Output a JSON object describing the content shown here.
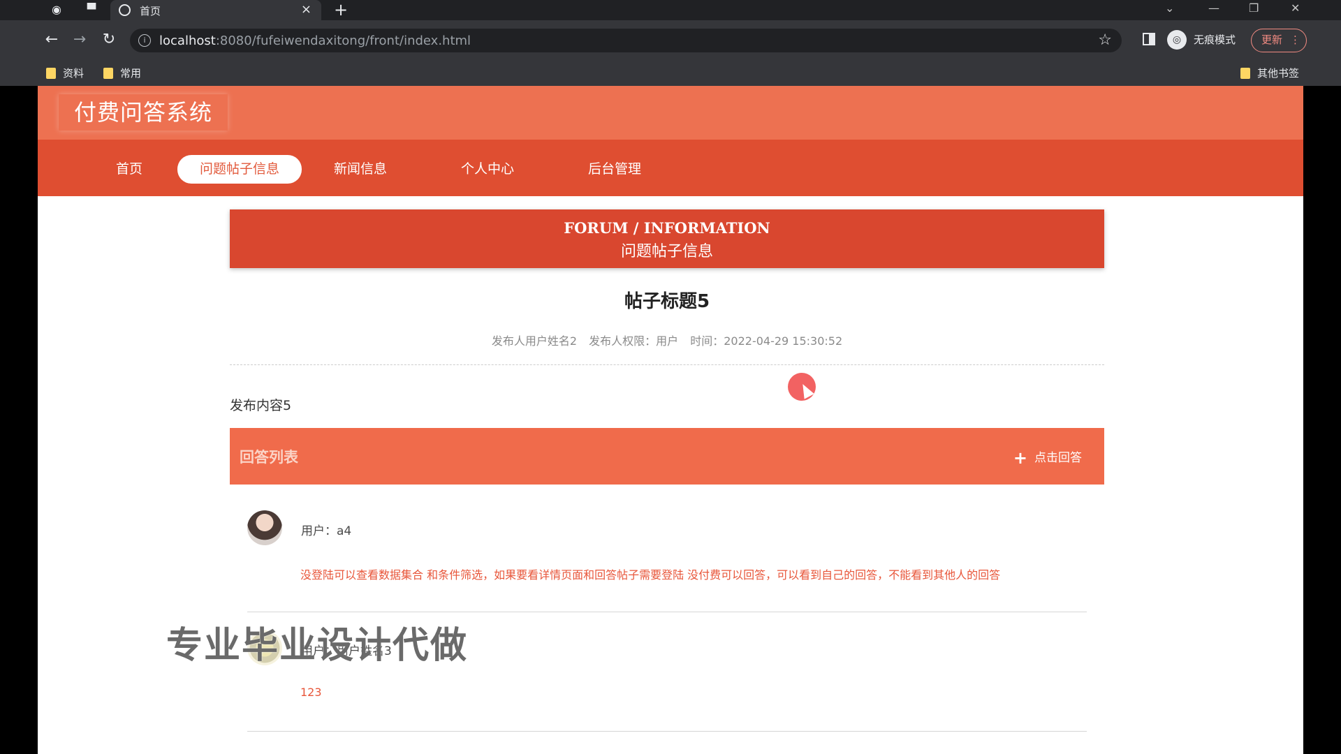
{
  "browser": {
    "tab_title": "首页",
    "url_host": "localhost",
    "url_rest": ":8080/fufeiwendaxitong/front/index.html",
    "incognito_label": "无痕模式",
    "update_label": "更新",
    "bookmarks": [
      "资料",
      "常用"
    ],
    "other_bookmarks": "其他书签"
  },
  "site": {
    "logo": "付费问答系统",
    "nav": [
      {
        "label": "首页",
        "active": false
      },
      {
        "label": "问题帖子信息",
        "active": true
      },
      {
        "label": "新闻信息",
        "active": false
      },
      {
        "label": "个人中心",
        "active": false
      },
      {
        "label": "后台管理",
        "active": false
      }
    ]
  },
  "banner": {
    "en": "FORUM / INFORMATION",
    "cn": "问题帖子信息"
  },
  "post": {
    "title": "帖子标题5",
    "meta_author": "发布人用户姓名2",
    "meta_role": "发布人权限：用户",
    "meta_time": "时间：2022-04-29 15:30:52",
    "content": "发布内容5"
  },
  "answers": {
    "title": "回答列表",
    "add_button": "点击回答",
    "items": [
      {
        "user": "用户：a4",
        "text": "没登陆可以查看数据集合 和条件筛选，如果要看详情页面和回答帖子需要登陆 没付费可以回答，可以看到自己的回答，不能看到其他人的回答"
      },
      {
        "user": "用户：用户姓名3",
        "text": "123"
      }
    ]
  },
  "watermark": "专业毕业设计代做",
  "colors": {
    "header": "#ed7151",
    "navbar": "#df4e31",
    "banner": "#d9472f",
    "answers_bar": "#f06b4b",
    "answer_text": "#e8563a"
  }
}
